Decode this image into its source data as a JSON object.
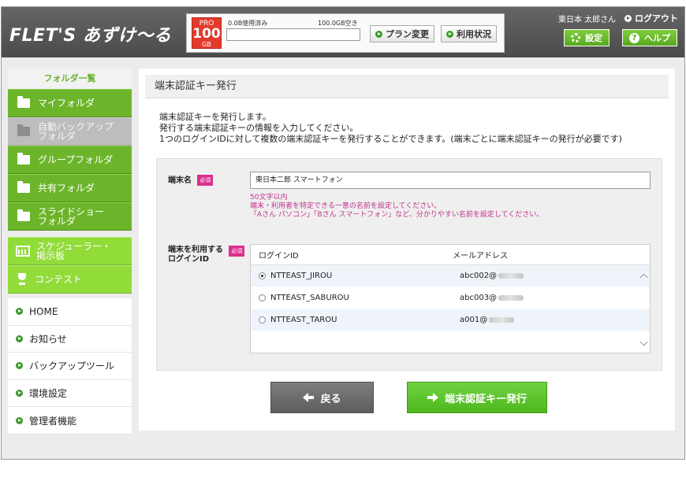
{
  "header": {
    "logo_text": "FLET'S あずけ〜る",
    "plan": {
      "badge_top": "PRO",
      "badge_value": "100",
      "badge_unit": "GB"
    },
    "usage": {
      "used_label": "0.0B使用済み",
      "free_label": "100.0GB空き",
      "used_fraction": 0.0
    },
    "plan_change_label": "プラン変更",
    "usage_status_label": "利用状況",
    "user_name": "東日本 太郎さん",
    "logout_label": "ログアウト",
    "settings_label": "設定",
    "help_label": "ヘルプ"
  },
  "sidebar": {
    "title": "フォルダ一覧",
    "folders": [
      {
        "label": "マイフォルダ",
        "enabled": true
      },
      {
        "label": "自動バックアップ\nフォルダ",
        "enabled": false
      },
      {
        "label": "グループフォルダ",
        "enabled": true
      },
      {
        "label": "共有フォルダ",
        "enabled": true
      },
      {
        "label": "スライドショー\nフォルダ",
        "enabled": true
      }
    ],
    "extras": [
      {
        "label": "スケジューラー・\n掲示板",
        "icon": "calendar-icon"
      },
      {
        "label": "コンテスト",
        "icon": "trophy-icon"
      }
    ],
    "links": [
      "HOME",
      "お知らせ",
      "バックアップツール",
      "環境設定",
      "管理者機能"
    ]
  },
  "main": {
    "title": "端末認証キー発行",
    "intro": [
      "端末認証キーを発行します。",
      "発行する端末認証キーの情報を入力してください。",
      "1つのログインIDに対して複数の端末認証キーを発行することができます。(端末ごとに端末認証キーの発行が必要です)"
    ],
    "device_name": {
      "label": "端末名",
      "required": "必須",
      "value": "東日本二郎 スマートフォン",
      "hints": [
        "50文字以内",
        "端末・利用者を特定できる一意の名前を設定してください。",
        "「Aさん パソコン」「Bさん スマートフォン」など、分かりやすい名前を設定してください。"
      ]
    },
    "user_select": {
      "label": "端末を利用する\nログインID",
      "required": "必須",
      "columns": [
        "ログインID",
        "メールアドレス"
      ],
      "rows": [
        {
          "login_id": "NTTEAST_JIROU",
          "email_prefix": "abc002@",
          "selected": true
        },
        {
          "login_id": "NTTEAST_SABUROU",
          "email_prefix": "abc003@",
          "selected": false
        },
        {
          "login_id": "NTTEAST_TAROU",
          "email_prefix": "a001@",
          "selected": false
        }
      ]
    },
    "back_label": "戻る",
    "issue_label": "端末認証キー発行"
  }
}
